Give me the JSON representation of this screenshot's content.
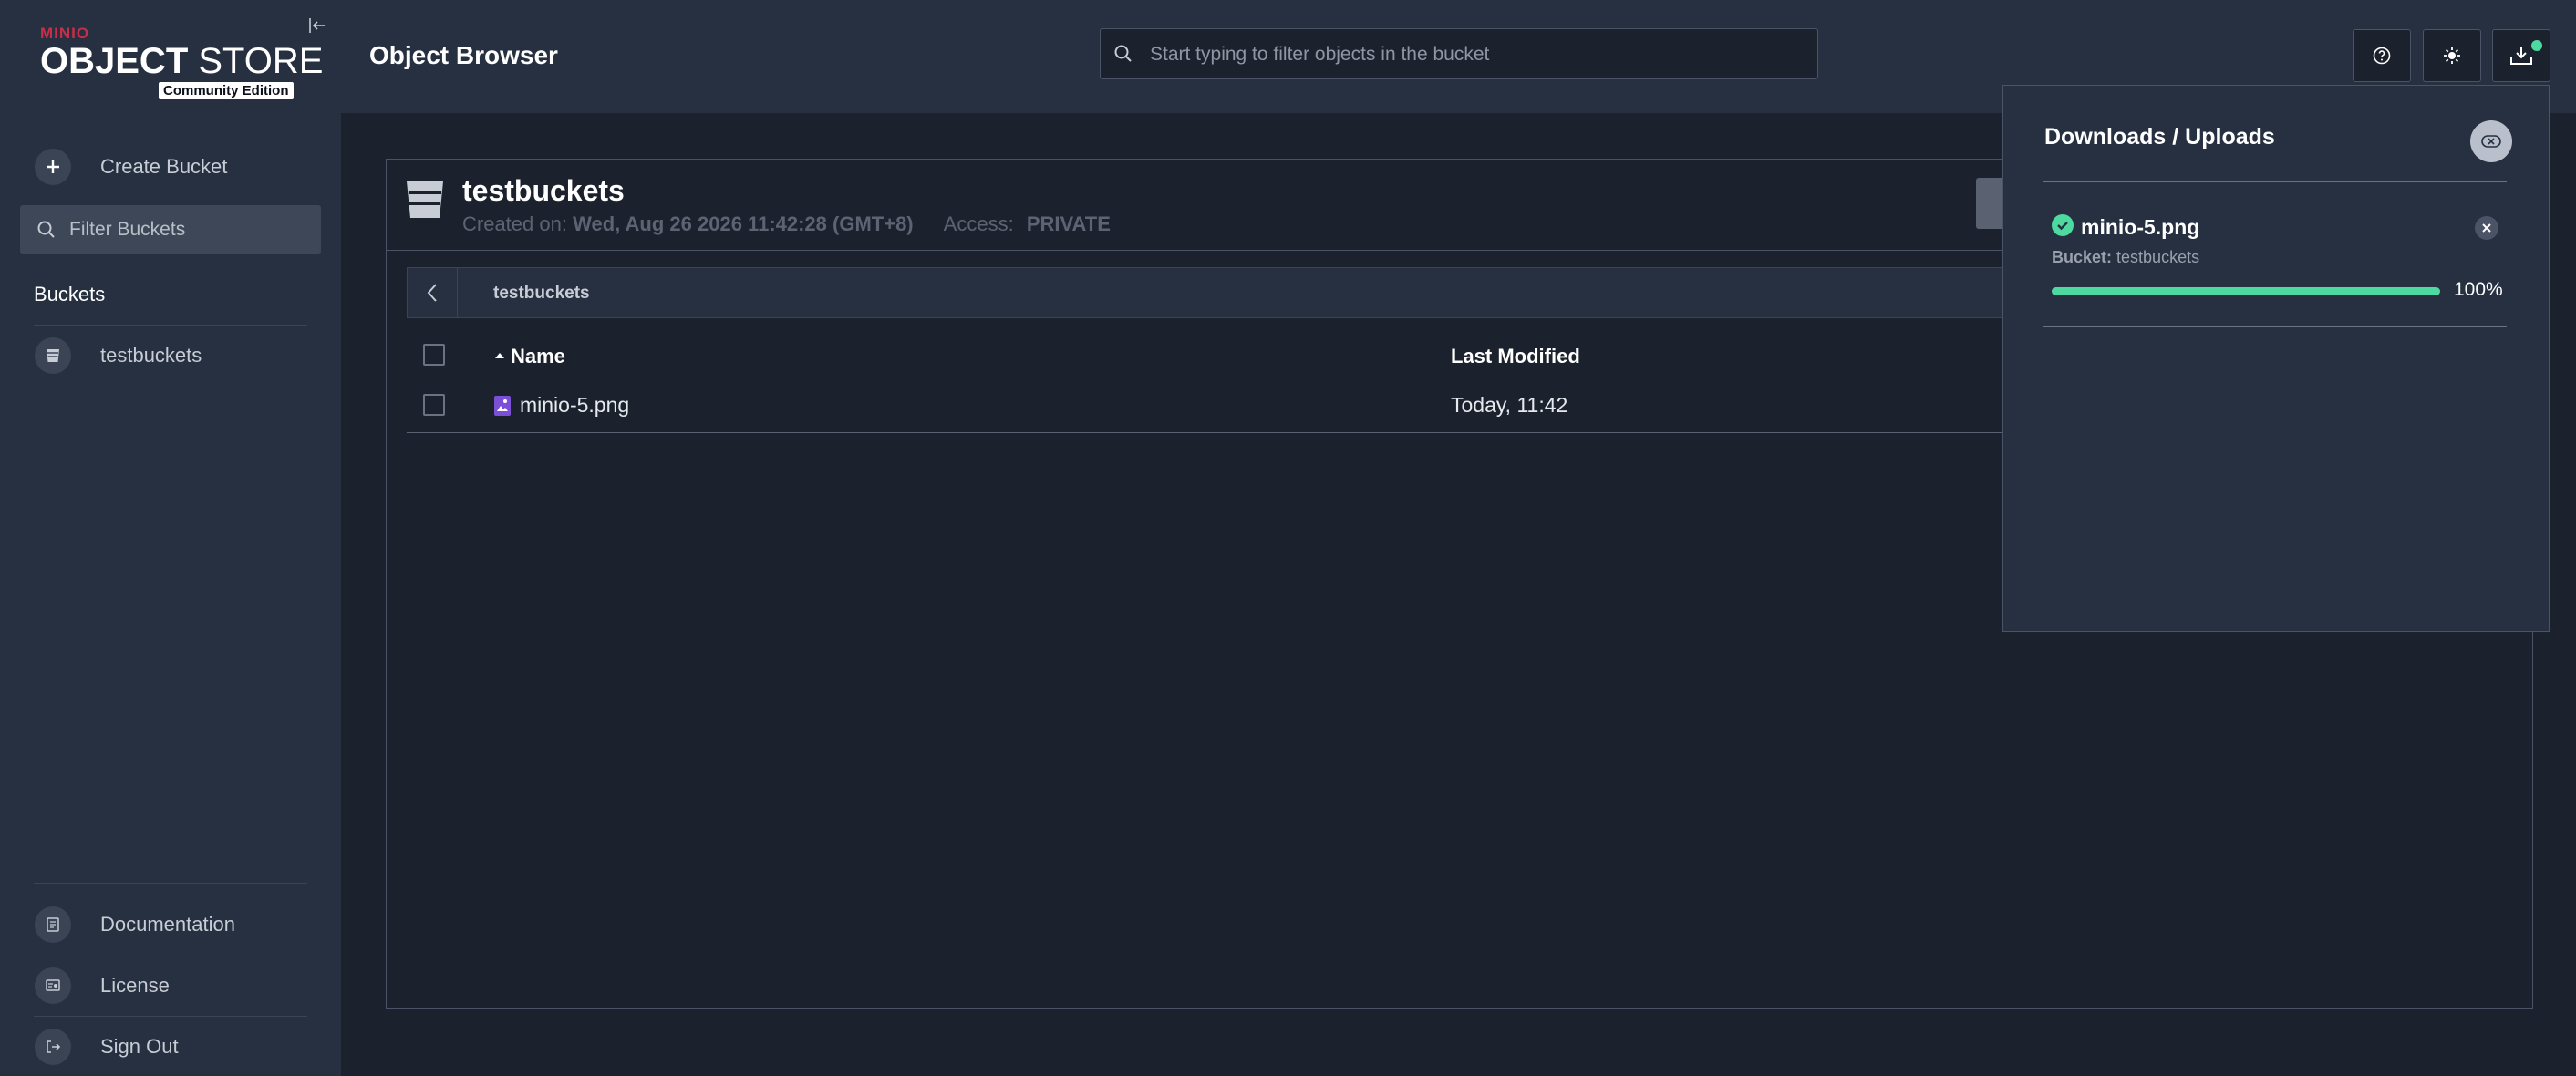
{
  "sidebar": {
    "logo_brand": "MINIO",
    "logo_title_bold": "OBJECT",
    "logo_title_light": "STORE",
    "logo_edition": "Community Edition",
    "create_bucket": "Create Bucket",
    "filter_placeholder": "Filter Buckets",
    "buckets_heading": "Buckets",
    "buckets": [
      {
        "name": "testbuckets"
      }
    ],
    "footer": {
      "documentation": "Documentation",
      "license": "License",
      "sign_out": "Sign Out"
    }
  },
  "header": {
    "title": "Object Browser",
    "search_placeholder": "Start typing to filter objects in the bucket"
  },
  "bucket": {
    "name": "testbuckets",
    "created_label": "Created on:",
    "created_value": "Wed, Aug 26 2026 11:42:28 (GMT+8)",
    "access_label": "Access:",
    "access_value": "PRIVATE"
  },
  "breadcrumb": {
    "path": "testbuckets"
  },
  "table": {
    "columns": {
      "name": "Name",
      "last_modified": "Last Modified"
    },
    "rows": [
      {
        "name": "minio-5.png",
        "last_modified": "Today, 11:42"
      }
    ]
  },
  "downloads": {
    "title": "Downloads / Uploads",
    "items": [
      {
        "name": "minio-5.png",
        "bucket_label": "Bucket:",
        "bucket": "testbuckets",
        "progress": 100,
        "progress_text": "100%",
        "status": "complete"
      }
    ]
  },
  "colors": {
    "accent_green": "#4dd9a0",
    "brand_red": "#c72e49",
    "file_icon_purple": "#7b4fd6"
  }
}
